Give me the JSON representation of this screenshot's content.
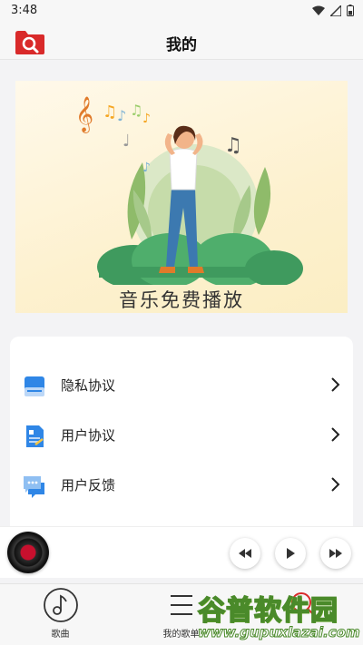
{
  "status_bar": {
    "time": "3:48"
  },
  "header": {
    "title": "我的"
  },
  "banner": {
    "caption": "音乐免费播放"
  },
  "menu": {
    "items": [
      {
        "label": "隐私协议",
        "icon": "book-icon"
      },
      {
        "label": "用户协议",
        "icon": "document-icon"
      },
      {
        "label": "用户反馈",
        "icon": "chat-bubble-icon"
      }
    ]
  },
  "player": {
    "controls": [
      "previous",
      "play",
      "next"
    ]
  },
  "tabs": [
    {
      "label": "歌曲",
      "icon": "music-note-icon"
    },
    {
      "label": "我的歌单",
      "icon": "playlist-icon"
    },
    {
      "label": "",
      "icon": "search-icon"
    }
  ],
  "watermark": {
    "title": "谷普软件园",
    "url": "www.gupuxlazai.com"
  },
  "colors": {
    "accent_red": "#d92a2a",
    "icon_blue": "#2f86e6"
  }
}
